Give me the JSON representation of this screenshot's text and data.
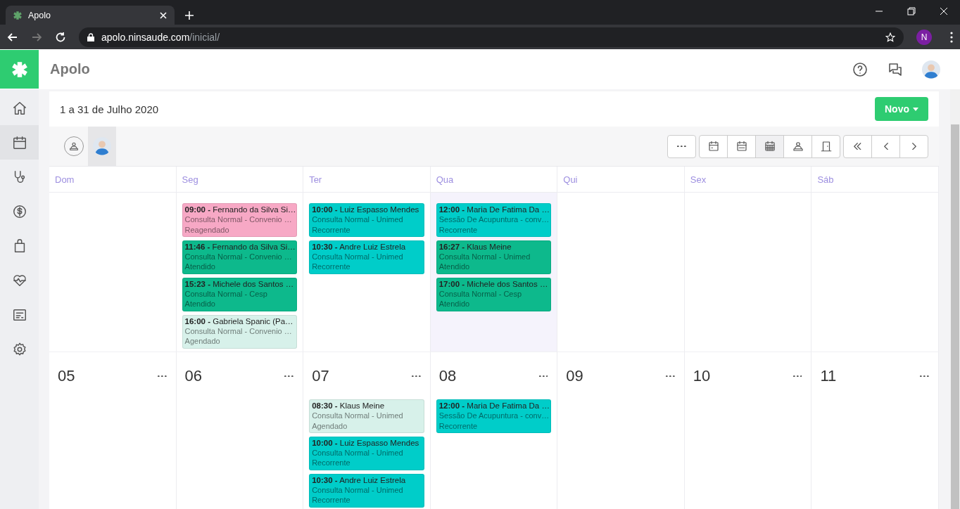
{
  "browser": {
    "tab_title": "Apolo",
    "url_host": "apolo.ninsaude.com",
    "url_path": "/inicial/",
    "profile_initial": "N"
  },
  "app": {
    "title": "Apolo"
  },
  "sidebar": {
    "items": [
      {
        "kind": "home",
        "selected": false
      },
      {
        "kind": "calendar",
        "selected": true
      },
      {
        "kind": "stethoscope",
        "selected": false
      },
      {
        "kind": "money",
        "selected": false
      },
      {
        "kind": "bag",
        "selected": false
      },
      {
        "kind": "heart",
        "selected": false
      },
      {
        "kind": "document",
        "selected": false
      },
      {
        "kind": "settings",
        "selected": false
      }
    ]
  },
  "calendar": {
    "period": "1 a 31 de Julho 2020",
    "new_button": "Novo",
    "filters": [
      {
        "kind": "all",
        "selected": false
      },
      {
        "kind": "avatar",
        "selected": true
      }
    ],
    "views": [
      {
        "kind": "week",
        "selected": false
      },
      {
        "kind": "fortnight",
        "selected": false
      },
      {
        "kind": "month",
        "selected": true
      },
      {
        "kind": "professional",
        "selected": false
      },
      {
        "kind": "room",
        "selected": false
      }
    ],
    "weekdays": [
      "Dom",
      "Seg",
      "Ter",
      "Qua",
      "Qui",
      "Sex",
      "Sáb"
    ],
    "weeks": [
      {
        "days": [
          {
            "today": false
          },
          {
            "today": false,
            "events": [
              {
                "title": "**09:00 -** Fernando da Silva Si…",
                "service": "Consulta Normal - Convenio …",
                "status": "Reagendado",
                "color": "#f7a8c5"
              },
              {
                "title": "**11:46 -** Fernando da Silva Si…",
                "service": "Consulta Normal - Convenio …",
                "status": "Atendido",
                "color": "#0db98c"
              },
              {
                "title": "**15:23 -** Michele dos Santos …",
                "service": "Consulta Normal - Cesp",
                "status": "Atendido",
                "color": "#0db98c"
              },
              {
                "title": "**16:00 -** Gabriela Spanic (Pa…",
                "service": "Consulta Normal - Convenio …",
                "status": "Agendado",
                "color": "#d7f1ea"
              }
            ]
          },
          {
            "today": false,
            "events": [
              {
                "title": "**10:00 -** Luiz Espasso Mendes",
                "service": "Consulta Normal - Unimed",
                "status": "Recorrente",
                "color": "#00cdc9"
              },
              {
                "title": "**10:30 -** Andre Luiz Estrela",
                "service": "Consulta Normal - Unimed",
                "status": "Recorrente",
                "color": "#00cdc9"
              }
            ]
          },
          {
            "today": true,
            "events": [
              {
                "title": "**12:00 -** Maria De Fatima Da …",
                "service": "Sessão De Acupuntura - conv…",
                "status": "Recorrente",
                "color": "#00cdc9"
              },
              {
                "title": "**16:27 -** Klaus Meine",
                "service": "Consulta Normal - Unimed",
                "status": "Atendido",
                "color": "#0db98c"
              },
              {
                "title": "**17:00 -** Michele dos Santos …",
                "service": "Consulta Normal - Cesp",
                "status": "Atendido",
                "color": "#0db98c"
              }
            ]
          },
          {
            "today": false
          },
          {
            "today": false
          },
          {
            "today": false
          }
        ]
      },
      {
        "days": [
          {
            "date": "05",
            "today": false
          },
          {
            "date": "06",
            "today": false
          },
          {
            "date": "07",
            "today": false,
            "events": [
              {
                "title": "**08:30 -** Klaus Meine",
                "service": "Consulta Normal - Unimed",
                "status": "Agendado",
                "color": "#d7f1ea"
              },
              {
                "title": "**10:00 -** Luiz Espasso Mendes",
                "service": "Consulta Normal - Unimed",
                "status": "Recorrente",
                "color": "#00cdc9"
              },
              {
                "title": "**10:30 -** Andre Luiz Estrela",
                "service": "Consulta Normal - Unimed",
                "status": "Recorrente",
                "color": "#00cdc9"
              }
            ]
          },
          {
            "date": "08",
            "today": false,
            "events": [
              {
                "title": "**12:00 -** Maria De Fatima Da …",
                "service": "Sessão De Acupuntura - conv…",
                "status": "Recorrente",
                "color": "#00cdc9"
              }
            ]
          },
          {
            "date": "09",
            "today": false
          },
          {
            "date": "10",
            "today": false
          },
          {
            "date": "11",
            "today": false
          }
        ]
      }
    ]
  }
}
